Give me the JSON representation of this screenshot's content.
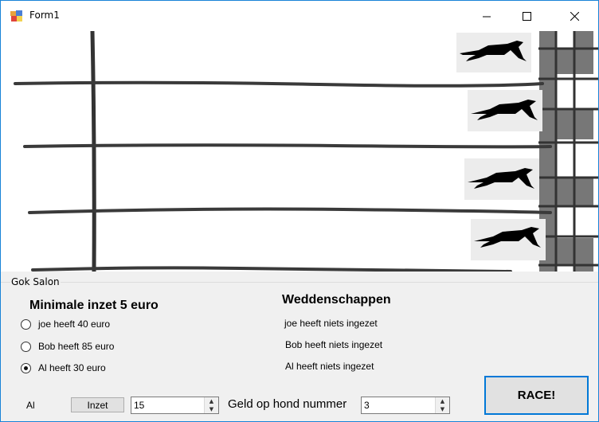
{
  "window": {
    "title": "Form1"
  },
  "groupbox": {
    "label": "Gok Salon"
  },
  "bet_panel": {
    "min_bet_heading": "Minimale inzet 5 euro",
    "players": [
      {
        "label": "joe heeft 40 euro",
        "checked": false
      },
      {
        "label": "Bob heeft 85 euro",
        "checked": false
      },
      {
        "label": "Al heeft 30 euro",
        "checked": true
      }
    ]
  },
  "bets": {
    "heading": "Weddenschappen",
    "lines": [
      "joe heeft niets ingezet",
      "Bob heeft niets ingezet",
      "Al heeft niets ingezet"
    ]
  },
  "controls": {
    "selected_name": "Al",
    "inzet_label": "Inzet",
    "amount_value": "15",
    "dog_label": "Geld op hond nummer",
    "dog_value": "3",
    "race_label": "RACE!"
  }
}
